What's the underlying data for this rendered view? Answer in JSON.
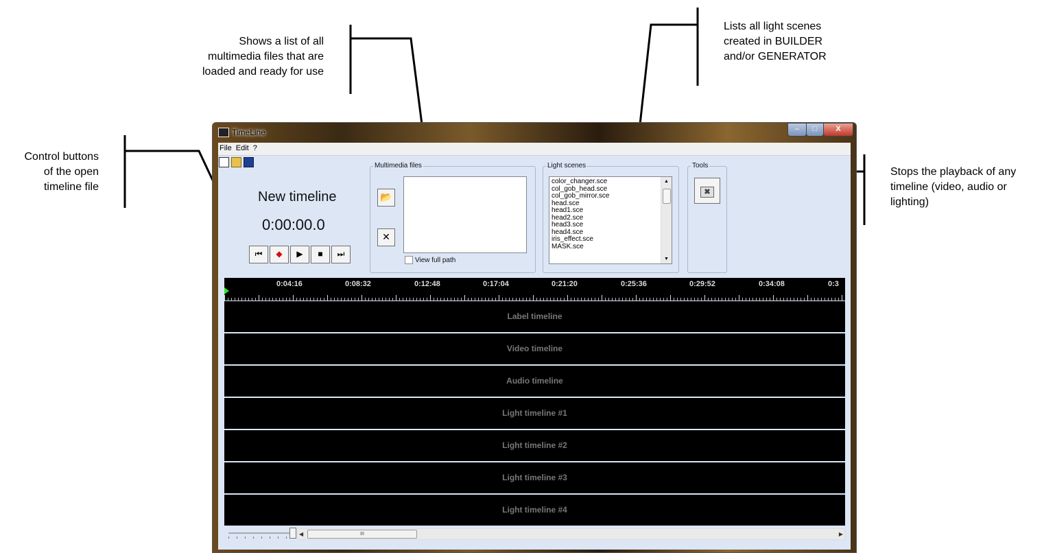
{
  "callouts": {
    "multimedia": [
      "Shows a list of all",
      "multimedia files that are",
      "loaded and ready for use"
    ],
    "scenes": [
      "Lists all light scenes",
      "created in BUILDER",
      "and/or GENERATOR"
    ],
    "control": [
      "Control buttons",
      "of the open",
      "timeline file"
    ],
    "stop": [
      "Stops the playback of any",
      "timeline  (video, audio or",
      "lighting)"
    ]
  },
  "window": {
    "title": "TimeLine",
    "controls": {
      "minimize": "–",
      "maximize": "□",
      "close": "X"
    }
  },
  "menu": [
    "File",
    "Edit",
    "?"
  ],
  "toolbar_icons": [
    "new-file-icon",
    "open-folder-icon",
    "save-disk-icon"
  ],
  "timeline": {
    "name": "New timeline",
    "time": "0:00:00.0"
  },
  "transport": {
    "first": "⏮",
    "record": "◆",
    "play": "▶",
    "stop": "■",
    "last": "⏭"
  },
  "multimedia": {
    "label": "Multimedia files",
    "open_icon": "📂",
    "remove_icon": "✕",
    "view_full_path": "View full path"
  },
  "light_scenes": {
    "label": "Light scenes",
    "items": [
      "color_changer.sce",
      "col_gob_head.sce",
      "col_gob_mirror.sce",
      "head.sce",
      "head1.sce",
      "head2.sce",
      "head3.sce",
      "head4.sce",
      "iris_effect.sce",
      "MASK.sce"
    ]
  },
  "tools": {
    "label": "Tools",
    "stop_icon": "✖"
  },
  "ruler": {
    "labels": [
      "0:04:16",
      "0:08:32",
      "0:12:48",
      "0:17:04",
      "0:21:20",
      "0:25:36",
      "0:29:52",
      "0:34:08",
      "0:3"
    ]
  },
  "tracks": [
    "Label timeline",
    "Video timeline",
    "Audio timeline",
    "Light timeline #1",
    "Light timeline #2",
    "Light timeline #3",
    "Light timeline #4"
  ],
  "scrollbar": {
    "left_arrow": "◀",
    "right_arrow": "▶",
    "thumb_grip": "III"
  }
}
